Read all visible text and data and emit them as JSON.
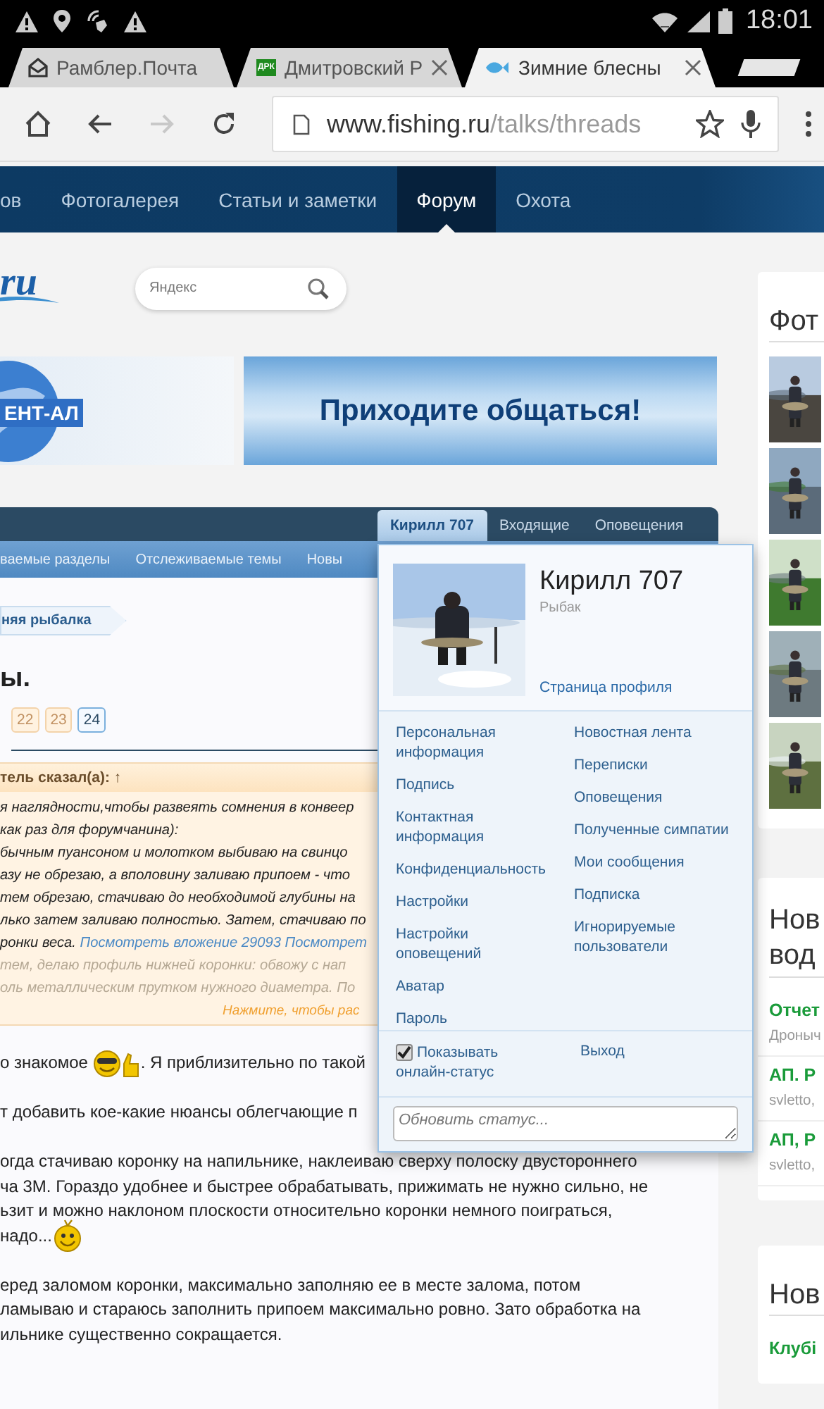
{
  "status_bar": {
    "time": "18:01"
  },
  "browser_tabs": [
    {
      "title": "Рамблер.Почта",
      "kind": "mail",
      "closable": false,
      "selected": false
    },
    {
      "title": "Дмитровский Р",
      "kind": "site",
      "favicon_text": "ДРК",
      "closable": true,
      "selected": false
    },
    {
      "title": "Зимние блесны",
      "kind": "fish",
      "closable": true,
      "selected": true
    }
  ],
  "address_bar": {
    "domain": "www.fishing.ru",
    "path": "/talks/threads",
    "forward_disabled": true
  },
  "site_nav": [
    {
      "label": "ов",
      "selected": false
    },
    {
      "label": "Фотогалерея",
      "selected": false
    },
    {
      "label": "Статьи и заметки",
      "selected": false
    },
    {
      "label": "Форум",
      "selected": true
    },
    {
      "label": "Охота",
      "selected": false
    }
  ],
  "logo_fragment": "ru",
  "search": {
    "placeholder": "Яндекс"
  },
  "banners": [
    {
      "kind": "globe",
      "text": "ЕНТ-АЛ"
    },
    {
      "kind": "slogan",
      "text": "Приходите общаться!"
    }
  ],
  "forum": {
    "sub_nav": [
      "ваемые разделы",
      "Отслеживаемые темы",
      "Новы"
    ],
    "breadcrumb": "няя рыбалка",
    "title": "ы.",
    "pages": [
      {
        "label": "22",
        "selected": false
      },
      {
        "label": "23",
        "selected": false
      },
      {
        "label": "24",
        "selected": true
      }
    ],
    "quote": {
      "header": "тель сказал(а): ↑",
      "lines": [
        {
          "text": "я наглядности,чтобы развеять сомнения в конвеер",
          "faded": false
        },
        {
          "text": "как раз для форумчанина):",
          "faded": false
        },
        {
          "text": "бычным пуансоном и молотком выбиваю на свинцо",
          "faded": false
        },
        {
          "text": "азу не обрезаю, а вполовину заливаю припоем - что",
          "faded": false
        },
        {
          "text": "тем обрезаю, стачиваю до необходимой глубины на",
          "faded": false
        },
        {
          "text": "лько затем заливаю полностью. Затем, стачиваю по",
          "faded": false
        },
        {
          "text": "ронки веса. ",
          "link": "Посмотреть вложение 29093 Посмотрет",
          "faded": false
        },
        {
          "text": "тем, делаю профиль нижней коронки: обвожу с нап",
          "faded": true
        },
        {
          "text": "оль металлическим прутком нужного диаметра. По",
          "faded": true
        }
      ],
      "expand": "Нажмите, чтобы рас"
    },
    "post": [
      [
        [
          {
            "kind": "text",
            "text": "о знакомое "
          },
          {
            "kind": "cool"
          },
          {
            "kind": "text",
            "text": ". Я приблизительно по такой"
          }
        ]
      ],
      [
        [
          {
            "kind": "text",
            "text": "т добавить кое-какие нюансы облегчающие п"
          }
        ]
      ],
      [
        [
          {
            "kind": "text",
            "text": "огда стачиваю коронку на напильнике, наклеиваю сверху полоску двустороннего"
          }
        ],
        [
          {
            "kind": "text",
            "text": "ча 3М. Гораздо удобнее и быстрее обрабатывать, прижимать не нужно сильно, не"
          }
        ],
        [
          {
            "kind": "text",
            "text": "ьзит и можно наклоном плоскости относительно коронки немного поиграться,"
          }
        ],
        [
          {
            "kind": "text",
            "text": " надо..."
          },
          {
            "kind": "grin"
          }
        ]
      ],
      [
        [
          {
            "kind": "text",
            "text": "еред заломом коронки, максимально заполняю ее в месте залома, потом"
          }
        ],
        [
          {
            "kind": "text",
            "text": "ламываю и стараюсь заполнить припоем максимально ровно. Зато обработка на"
          }
        ],
        [
          {
            "kind": "text",
            "text": "ильнике существенно сокращается."
          }
        ]
      ]
    ]
  },
  "user_menu": {
    "tabs": [
      {
        "label": "Кирилл 707",
        "selected": true
      },
      {
        "label": "Входящие",
        "selected": false
      },
      {
        "label": "Оповещения",
        "selected": false
      }
    ],
    "name": "Кирилл 707",
    "user_title": "Рыбак",
    "profile_link": "Страница профиля",
    "left_links": [
      "Персональная информация",
      "Подпись",
      "Контактная информация",
      "Конфиденциальность",
      "Настройки",
      "Настройки оповещений",
      "Аватар",
      "Пароль"
    ],
    "right_links": [
      "Новостная лента",
      "Переписки",
      "Оповещения",
      "Полученные симпатии",
      "Мои сообщения",
      "Подписка",
      "Игнорируемые пользователи"
    ],
    "show_online": {
      "label": "Показывать онлайн-статус",
      "checked": true
    },
    "logout": "Выход",
    "status_placeholder": "Обновить статус..."
  },
  "sidebar": {
    "photo_card": {
      "title": "Фот"
    },
    "threads_card": {
      "title_lines": [
        "Нов",
        "вод"
      ],
      "items": [
        {
          "title": "Отчет",
          "author": "Дроныч"
        },
        {
          "title": "АП. Р",
          "author": "svletto,"
        },
        {
          "title": "АП, Р",
          "author": "svletto,"
        }
      ]
    },
    "clubs_card": {
      "title": "Нов",
      "items": [
        {
          "title": "Клубі"
        }
      ]
    }
  }
}
